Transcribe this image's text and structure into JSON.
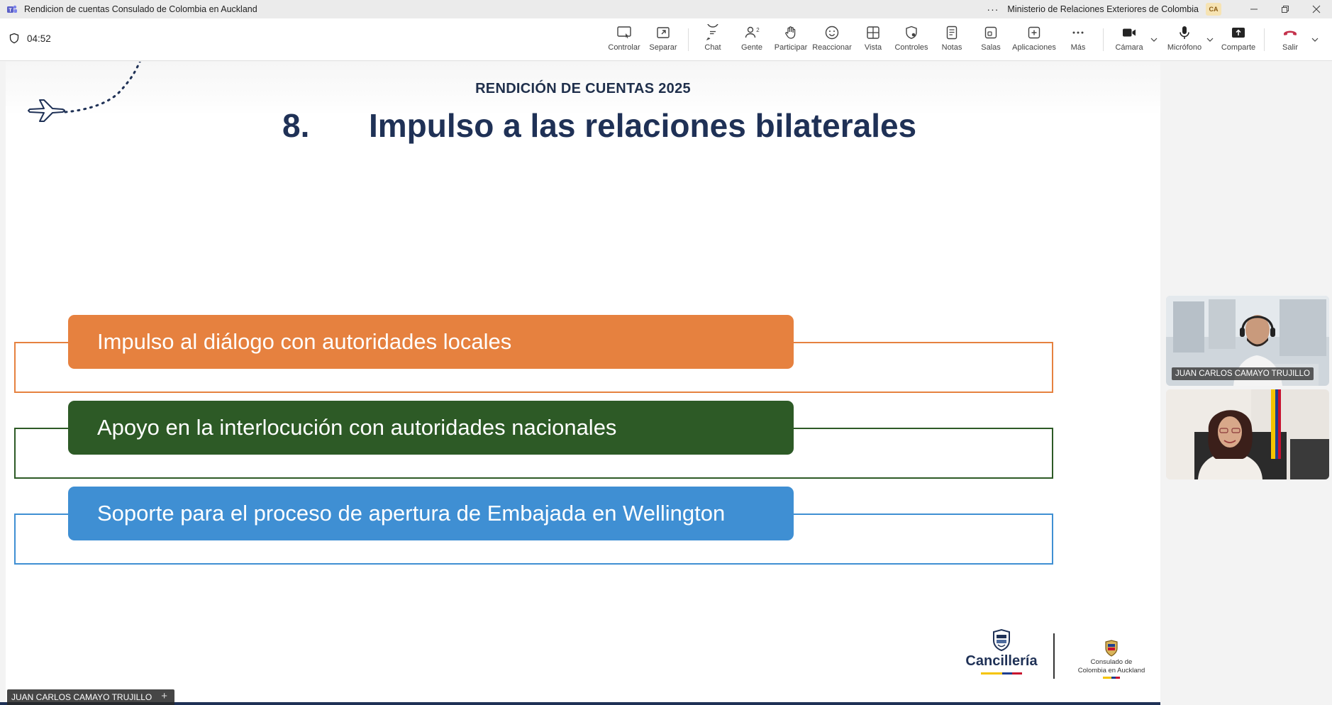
{
  "window": {
    "title": "Rendicion de cuentas Consulado de Colombia en Auckland",
    "more": "···",
    "organization": "Ministerio de Relaciones Exteriores de Colombia",
    "user_initials": "CA"
  },
  "toolbar": {
    "timer": "04:52",
    "items": [
      {
        "label": "Controlar",
        "icon": "control-screen-icon"
      },
      {
        "label": "Separar",
        "icon": "pop-out-icon"
      },
      {
        "label": "Chat",
        "icon": "chat-icon"
      },
      {
        "label": "Gente",
        "icon": "people-icon",
        "badge": "2"
      },
      {
        "label": "Participar",
        "icon": "raise-hand-icon"
      },
      {
        "label": "Reaccionar",
        "icon": "react-emoji-icon"
      },
      {
        "label": "Vista",
        "icon": "view-grid-icon"
      },
      {
        "label": "Controles",
        "icon": "shield-settings-icon"
      },
      {
        "label": "Notas",
        "icon": "notes-icon"
      },
      {
        "label": "Salas",
        "icon": "rooms-icon"
      },
      {
        "label": "Aplicaciones",
        "icon": "add-apps-icon"
      },
      {
        "label": "Más",
        "icon": "more-icon"
      },
      {
        "label": "Cámara",
        "icon": "camera-icon"
      },
      {
        "label": "Micrófono",
        "icon": "microphone-icon"
      },
      {
        "label": "Comparte",
        "icon": "share-icon"
      },
      {
        "label": "Salir",
        "icon": "leave-phone-icon"
      }
    ],
    "colors": {
      "leave": "#c4314b",
      "icons": "#424242"
    }
  },
  "slide": {
    "subtitle": "RENDICIÓN DE CUENTAS 2025",
    "number": "8.",
    "title": "Impulso a las relaciones bilaterales",
    "items": [
      {
        "text": "Impulso al diálogo con autoridades locales",
        "color": "#e6813f",
        "frame_color": "#e6813f"
      },
      {
        "text": "Apoyo en la interlocución con autoridades nacionales",
        "color": "#2d5a26",
        "frame_color": "#2d5a26"
      },
      {
        "text": "Soporte para el proceso de apertura de Embajada en Wellington",
        "color": "#3f8fd3",
        "frame_color": "#3f8fd3"
      }
    ],
    "logos": {
      "cancilleria": "Cancillería",
      "consulado_line1": "Consulado de",
      "consulado_line2": "Colombia en Auckland"
    },
    "colors": {
      "title": "#1f3156"
    }
  },
  "presenter": {
    "name": "JUAN CARLOS CAMAYO TRUJILLO"
  },
  "participants": [
    {
      "name": "JUAN CARLOS CAMAYO TRUJILLO"
    },
    {
      "name": ""
    }
  ]
}
